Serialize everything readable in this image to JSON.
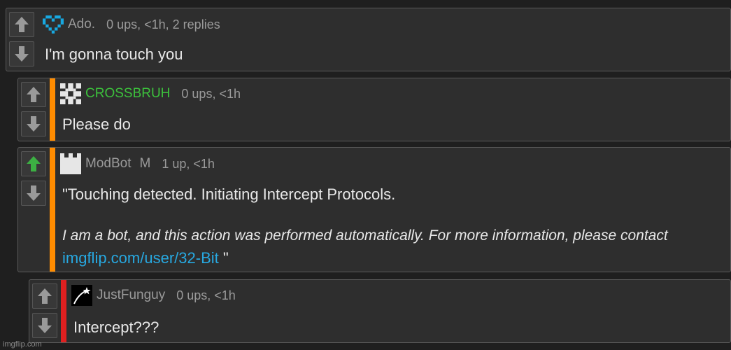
{
  "comments": [
    {
      "username": "Ado.",
      "meta": "0 ups, <1h, 2 replies",
      "text": "I'm gonna touch you",
      "avatar": "pixel-heart-icon"
    },
    {
      "username": "CROSSBRUH",
      "meta": "0 ups, <1h",
      "text": "Please do",
      "stripe_color": "#ff8c00",
      "username_color": "#3cc13c",
      "avatar": "pixel-cross-icon"
    },
    {
      "username": "ModBot",
      "mod_badge": "M",
      "meta": "1 up, <1h",
      "text": "\"Touching detected. Initiating Intercept Protocols.",
      "bot_notice": "I am a bot, and this action was performed automatically. For more information, please contact",
      "link": "imgflip.com/user/32-Bit",
      "closing": " \"",
      "stripe_color": "#ff8c00",
      "upvote_color": "#3cb043",
      "avatar": "castle-tower-icon"
    },
    {
      "username": "JustFunguy",
      "meta": "0 ups, <1h",
      "text": "Intercept???",
      "stripe_color": "#e02020",
      "avatar": "shooting-star-icon"
    }
  ],
  "watermark": "imgflip.com"
}
